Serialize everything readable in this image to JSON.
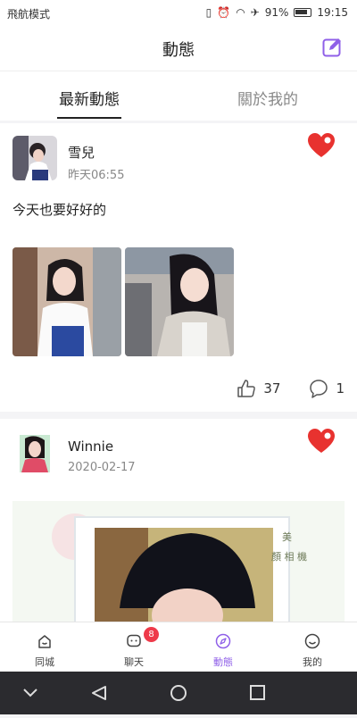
{
  "status": {
    "mode": "飛航模式",
    "battery": "91%",
    "time": "19:15"
  },
  "header": {
    "title": "動態"
  },
  "tabs": [
    {
      "label": "最新動態"
    },
    {
      "label": "關於我的"
    }
  ],
  "posts": [
    {
      "user": "雪兒",
      "time": "昨天06:55",
      "text": "今天也要好好的",
      "likes": "37",
      "comments": "1"
    },
    {
      "user": "Winnie",
      "time": "2020-02-17"
    }
  ],
  "nav": {
    "items": [
      {
        "label": "同城"
      },
      {
        "label": "聊天"
      },
      {
        "label": "動態"
      },
      {
        "label": "我的"
      }
    ],
    "chat_badge": "8",
    "accent": "#8f5fe8"
  }
}
